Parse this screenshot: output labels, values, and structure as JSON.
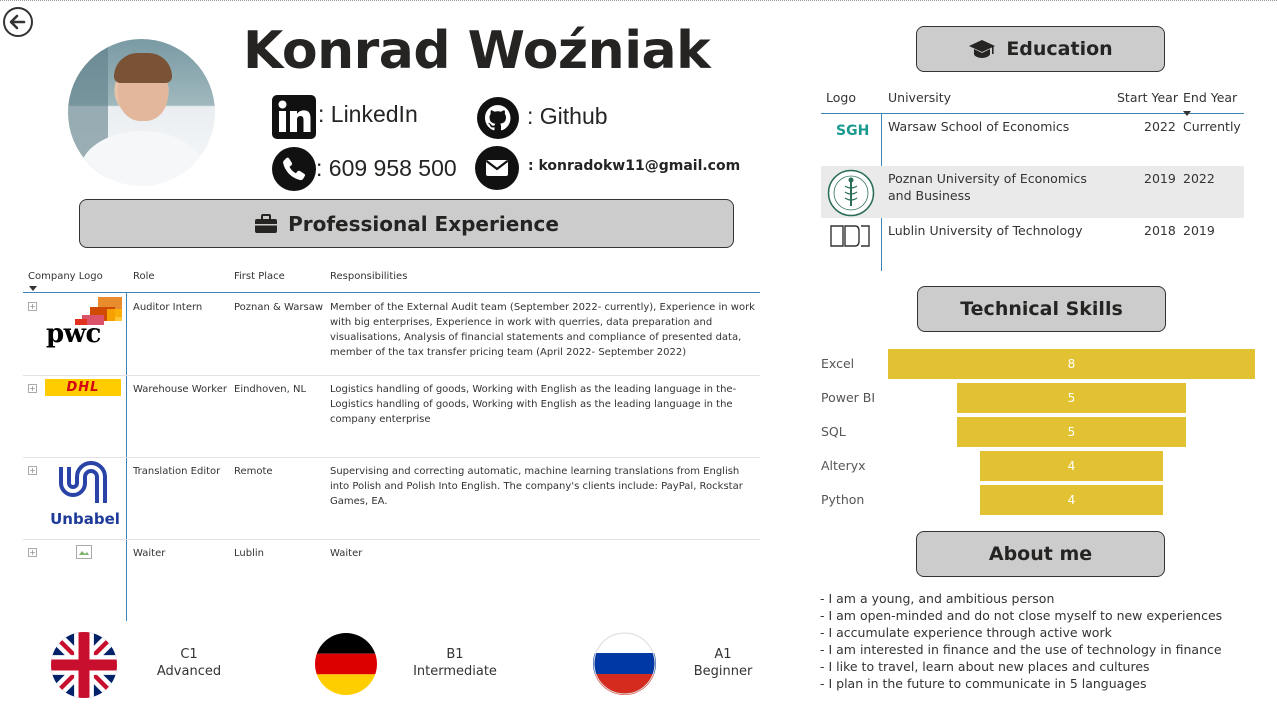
{
  "header": {
    "name": "Konrad Woźniak",
    "linkedin_label": ": LinkedIn",
    "github_label": ": Github",
    "phone": ": 609 958 500",
    "email": ": konradokw11@gmail.com"
  },
  "sections": {
    "experience": "Professional Experience",
    "education": "Education",
    "skills": "Technical Skills",
    "about": "About me"
  },
  "experience": {
    "columns": [
      "Company Logo",
      "Role",
      "First Place",
      "Responsibilities"
    ],
    "rows": [
      {
        "logo": "pwc-logo",
        "logo_text": "pwc",
        "role": "Auditor Intern",
        "place": "Poznan & Warsaw",
        "resp": "Member of the External Audit team (September 2022- currently), Experience in work with big enterprises, Experience in work with querries, data preparation and visualisations, Analysis of financial statements and compliance of presented data, member of the tax transfer pricing team (April 2022- September 2022)"
      },
      {
        "logo": "dhl-logo",
        "logo_text": "DHL",
        "role": "Warehouse Worker",
        "place": "Eindhoven, NL",
        "resp": "Logistics handling of goods, Working with English as the leading language in the-Logistics handling of goods, Working with English as the leading language in the company enterprise"
      },
      {
        "logo": "unbabel-logo",
        "logo_text": "Unbabel",
        "role": "Translation Editor",
        "place": "Remote",
        "resp": "Supervising and correcting automatic, machine learning translations from English into Polish and Polish Into English. The company's clients include: PayPal, Rockstar Games, EA."
      },
      {
        "logo": "broken-image-icon",
        "logo_text": "",
        "role": "Waiter",
        "place": "Lublin",
        "resp": "Waiter"
      }
    ]
  },
  "education": {
    "columns": [
      "Logo",
      "University",
      "Start Year",
      "End Year"
    ],
    "rows": [
      {
        "logo_text": "SGH",
        "university": "Warsaw School of Economics",
        "start": "2022",
        "end": "Currently"
      },
      {
        "logo_text": "",
        "university": "Poznan University of Economics and Business",
        "start": "2019",
        "end": "2022"
      },
      {
        "logo_text": "",
        "university": "Lublin University of Technology",
        "start": "2018",
        "end": "2019"
      }
    ]
  },
  "skills": [
    {
      "name": "Excel",
      "level": "8"
    },
    {
      "name": "Power BI",
      "level": "5"
    },
    {
      "name": "SQL",
      "level": "5"
    },
    {
      "name": "Alteryx",
      "level": "4"
    },
    {
      "name": "Python",
      "level": "4"
    }
  ],
  "about": [
    "- I am a young, and ambitious person",
    "- I am open-minded and do not close myself to new experiences",
    "- I accumulate experience through active work",
    "- I am interested in finance and the use of technology in finance",
    "- I like to travel, learn about new places and cultures",
    "- I plan in the future to communicate in 5 languages"
  ],
  "languages": [
    {
      "flag": "uk-flag-icon",
      "level": "C1",
      "desc": "Advanced"
    },
    {
      "flag": "germany-flag-icon",
      "level": "B1",
      "desc": "Intermediate"
    },
    {
      "flag": "russia-flag-icon",
      "level": "A1",
      "desc": "Beginner"
    }
  ],
  "colors": {
    "accent_line": "#3d85b8",
    "skill_bar": "#e2c232",
    "pill_bg": "#cccccc"
  }
}
